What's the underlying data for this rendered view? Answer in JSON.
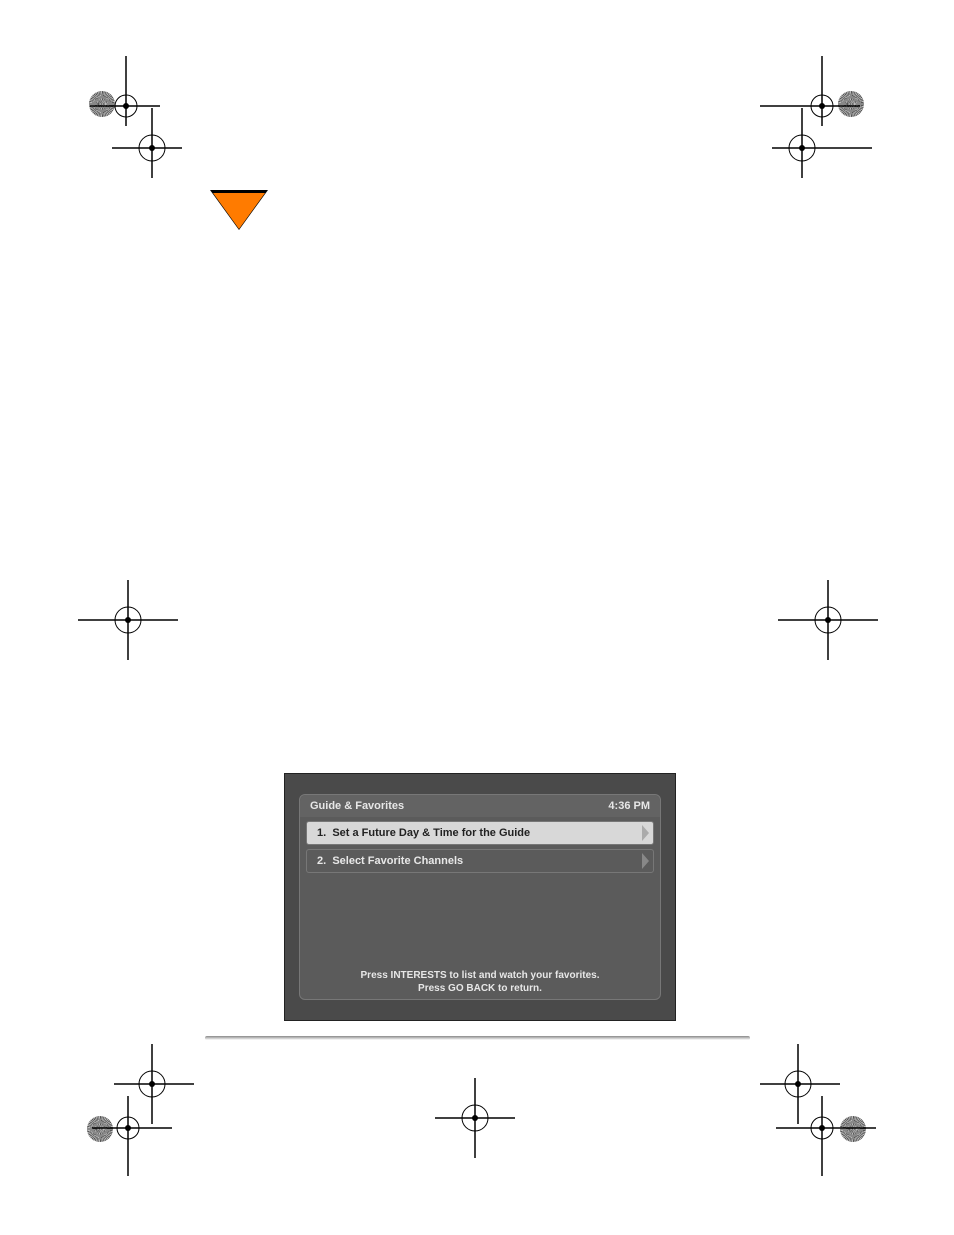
{
  "guide_panel": {
    "title": "Guide & Favorites",
    "clock": "4:36 PM",
    "items": [
      {
        "num": "1.",
        "label": "Set a Future Day & Time for the Guide",
        "selected": true
      },
      {
        "num": "2.",
        "label": "Select Favorite Channels",
        "selected": false
      }
    ],
    "footer_line1": "Press INTERESTS to list and watch your favorites.",
    "footer_line2": "Press GO BACK to return."
  }
}
